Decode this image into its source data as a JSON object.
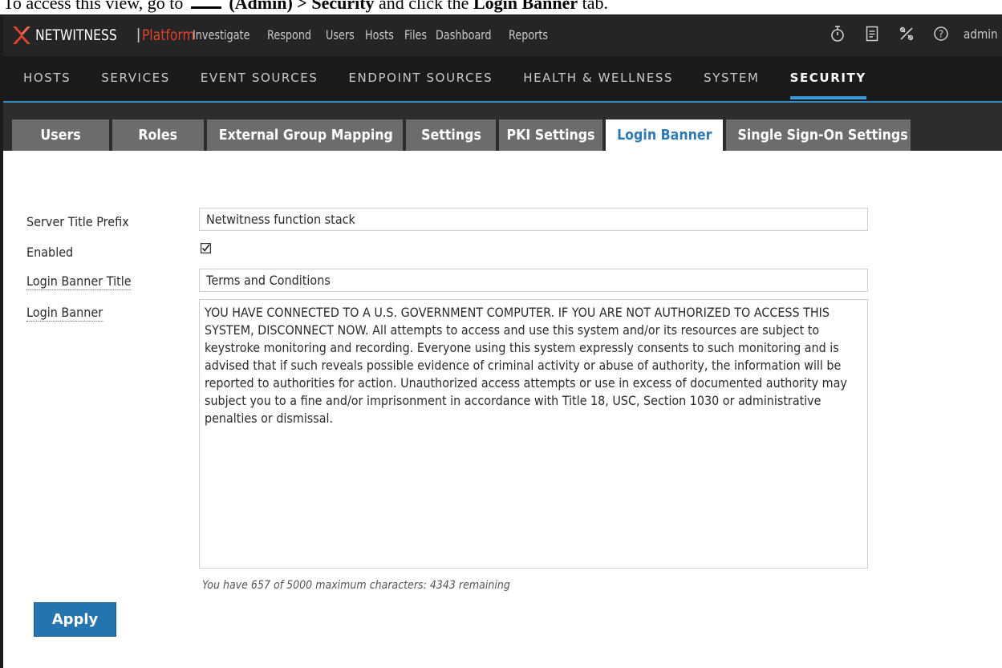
{
  "doc_caption": {
    "pre": "To access this view, go to",
    "admin": "(Admin)",
    "sep": " > ",
    "security": "Security",
    "mid": " and click the ",
    "tab": "Login Banner",
    "post": " tab."
  },
  "topnav": {
    "brand": "NETWITNESS",
    "product": "Platform",
    "links": [
      "Investigate",
      "Respond",
      "Users",
      "Hosts",
      "Files",
      "Dashboard",
      "Reports"
    ],
    "icons": [
      "timer-icon",
      "notes-icon",
      "tools-icon",
      "help-icon"
    ],
    "user": "admin"
  },
  "subnav": {
    "items": [
      "HOSTS",
      "SERVICES",
      "EVENT SOURCES",
      "ENDPOINT SOURCES",
      "HEALTH & WELLNESS",
      "SYSTEM",
      "SECURITY"
    ],
    "active": "SECURITY"
  },
  "tabs": {
    "items": [
      "Users",
      "Roles",
      "External Group Mapping",
      "Settings",
      "PKI Settings",
      "Login Banner",
      "Single Sign-On Settings"
    ],
    "active": "Login Banner"
  },
  "form": {
    "server_title_prefix": {
      "label": "Server Title Prefix",
      "value": "Netwitness function stack"
    },
    "enabled": {
      "label": "Enabled",
      "checked": true
    },
    "login_banner_title": {
      "label": "Login Banner Title",
      "value": "Terms and Conditions"
    },
    "login_banner": {
      "label": "Login Banner",
      "value": "YOU HAVE CONNECTED TO A U.S. GOVERNMENT COMPUTER. IF YOU ARE NOT AUTHORIZED TO ACCESS THIS SYSTEM, DISCONNECT NOW. All attempts to access and use this system and/or its resources are subject to keystroke monitoring and recording. Everyone using this system expressly consents to such monitoring and is advised that if such reveals possible evidence of criminal activity or abuse of authority, the information will be reported to authorities for action. Unauthorized access attempts or use in excess of documented authority may subject you to a fine and/or imprisonment in accordance with Title 18, USC, Section 1030 or administrative penalties or dismissal."
    },
    "char_hint": "You have 657 of 5000 maximum characters: 4343 remaining",
    "apply_label": "Apply"
  },
  "colors": {
    "topnav_bg": "#252525",
    "subnav_bg": "#1b1b1b",
    "accent": "#3a9bd8",
    "brand_red": "#e0442d",
    "tab_inactive": "#6c6c6c",
    "tab_active_text": "#2e7ab6",
    "apply_bg": "#2574b0"
  }
}
